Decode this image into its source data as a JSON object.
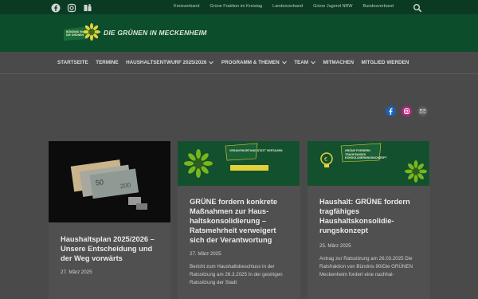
{
  "topbar": {
    "social_icons": [
      "facebook-icon",
      "instagram-icon",
      "medium-icon"
    ],
    "links": [
      "Kreisverband",
      "Grüne Fraktion im Kreistag",
      "Landesverband",
      "Grüne Jugend NRW",
      "Bundesverband"
    ],
    "search_icon": "search-icon"
  },
  "header": {
    "logo_text": "BÜNDNIS 90\nDIE GRÜNEN",
    "site_title": "DIE GRÜNEN IN MECKENHEIM"
  },
  "nav": {
    "items": [
      {
        "label": "STARTSEITE",
        "dropdown": false
      },
      {
        "label": "TERMINE",
        "dropdown": false
      },
      {
        "label": "HAUSHALTSENTWURF 2025/2026",
        "dropdown": true
      },
      {
        "label": "PROGRAMM & THEMEN",
        "dropdown": true
      },
      {
        "label": "TEAM",
        "dropdown": true
      },
      {
        "label": "MITMACHEN",
        "dropdown": false
      },
      {
        "label": "MITGLIED WERDEN",
        "dropdown": false
      }
    ]
  },
  "share": [
    "facebook-icon",
    "instagram-icon",
    "mail-icon"
  ],
  "posts": [
    {
      "title": "Haushaltsplan 2025/2026 – Unsere Entscheidung und der Weg vorwärts",
      "date": "27. März 2025",
      "excerpt": ""
    },
    {
      "title": "GRÜNE fordern konkrete Maßnahmen zur Haus­haltskonsolidierung – Ratsmehrheit verweigert sich der Verantwortung",
      "date": "27. März 2025",
      "excerpt": "Bericht zum Haushaltsbeschluss in der Ratssitzung am 26.3.2025 In der gestrigen Ratssitzung der Stadt",
      "banner": "VERANTWORTUNG STATT VERTAGEN"
    },
    {
      "title": "Haushalt: GRÜNE fordern tragfähiges Haushaltskonsolidie­rungskonzept",
      "date": "25. März 2025",
      "excerpt": "Antrag zur Ratssitzung am 26.03.2025 Die Ratsfraktion von Bündnis 90/Die GRÜNEN Meckenheim fordert eine nachhal-",
      "banner": "GRÜNE FORDERN TRAGFÄHIGES KONSOLIDIERUNGSKONZEPT"
    }
  ],
  "colors": {
    "topbar": "#0b3a22",
    "header": "#0c4d2c",
    "sunflower": "#7ab51d",
    "accent_yellow": "#e4d23a"
  }
}
